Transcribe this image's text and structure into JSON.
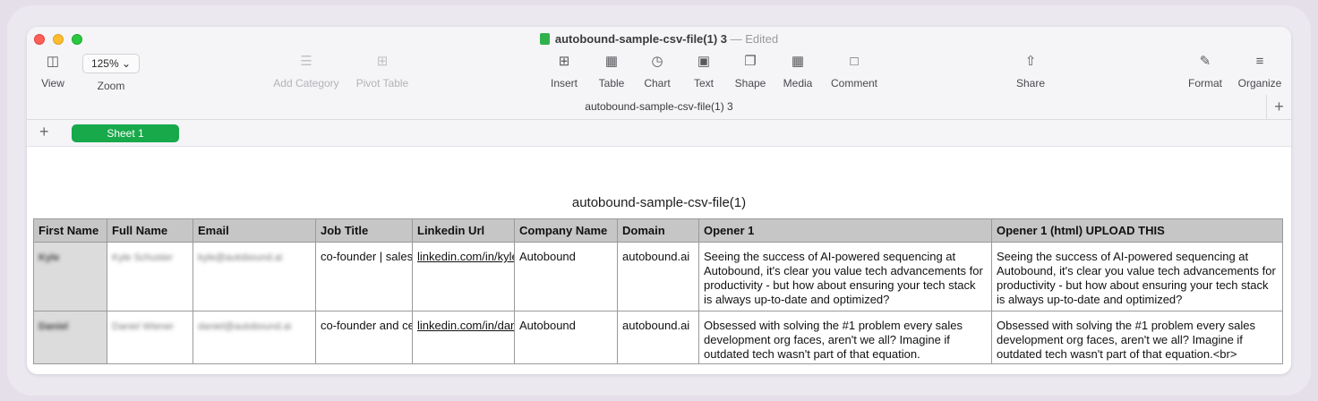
{
  "window": {
    "title": "autobound-sample-csv-file(1) 3",
    "separator": " — ",
    "status": "Edited",
    "doc_subtitle": "autobound-sample-csv-file(1) 3"
  },
  "toolbar": {
    "view_label": "View",
    "zoom_value": "125% ⌄",
    "zoom_label": "Zoom",
    "add_category_label": "Add Category",
    "pivot_table_label": "Pivot Table",
    "insert_label": "Insert",
    "table_label": "Table",
    "chart_label": "Chart",
    "text_label": "Text",
    "shape_label": "Shape",
    "media_label": "Media",
    "comment_label": "Comment",
    "share_label": "Share",
    "format_label": "Format",
    "organize_label": "Organize"
  },
  "icons": {
    "view": "sidebar-icon",
    "add_category": "list-icon",
    "pivot_table": "pivot-table-icon",
    "insert": "insert-icon",
    "table": "table-icon",
    "chart": "chart-icon",
    "text": "text-box-icon",
    "shape": "shape-icon",
    "media": "media-icon",
    "comment": "comment-icon",
    "share": "share-icon",
    "format": "paintbrush-icon",
    "organize": "organize-icon"
  },
  "colors": {
    "sheet_tab": "#17a94a",
    "header_bg": "#c6c6c6",
    "first_col_bg": "#dcdcdc"
  },
  "sheets": {
    "add_label": "+",
    "active_tab": "Sheet 1"
  },
  "table": {
    "title": "autobound-sample-csv-file(1)",
    "headers": [
      "First Name",
      "Full Name",
      "Email",
      "Job Title",
      "Linkedin Url",
      "Company Name",
      "Domain",
      "Opener 1",
      "Opener 1 (html) UPLOAD THIS"
    ],
    "rows": [
      {
        "first_name": "Kyle",
        "full_name": "Kyle Schuster",
        "email": "kyle@autobound.ai",
        "job_title": "co-founder | sales",
        "linkedin": "linkedin.com/in/kyle",
        "company": "Autobound",
        "domain": "autobound.ai",
        "opener": "Seeing the success of AI-powered sequencing at Autobound, it's clear you value tech advancements for productivity - but how about ensuring your tech stack is always up-to-date and optimized?",
        "opener_html": "Seeing the success of AI-powered sequencing at Autobound, it's clear you value tech advancements for productivity - but how about ensuring your tech stack is always up-to-date and optimized?"
      },
      {
        "first_name": "Daniel",
        "full_name": "Daniel Wiener",
        "email": "daniel@autobound.ai",
        "job_title": "co-founder and ceo",
        "linkedin": "linkedin.com/in/daniel",
        "company": "Autobound",
        "domain": "autobound.ai",
        "opener": "Obsessed with solving the #1 problem every sales development org faces, aren't we all? Imagine if outdated tech wasn't part of that equation.",
        "opener_html": "Obsessed with solving the #1 problem every sales development org faces, aren't we all? Imagine if outdated tech wasn't part of that equation.<br>"
      }
    ]
  }
}
